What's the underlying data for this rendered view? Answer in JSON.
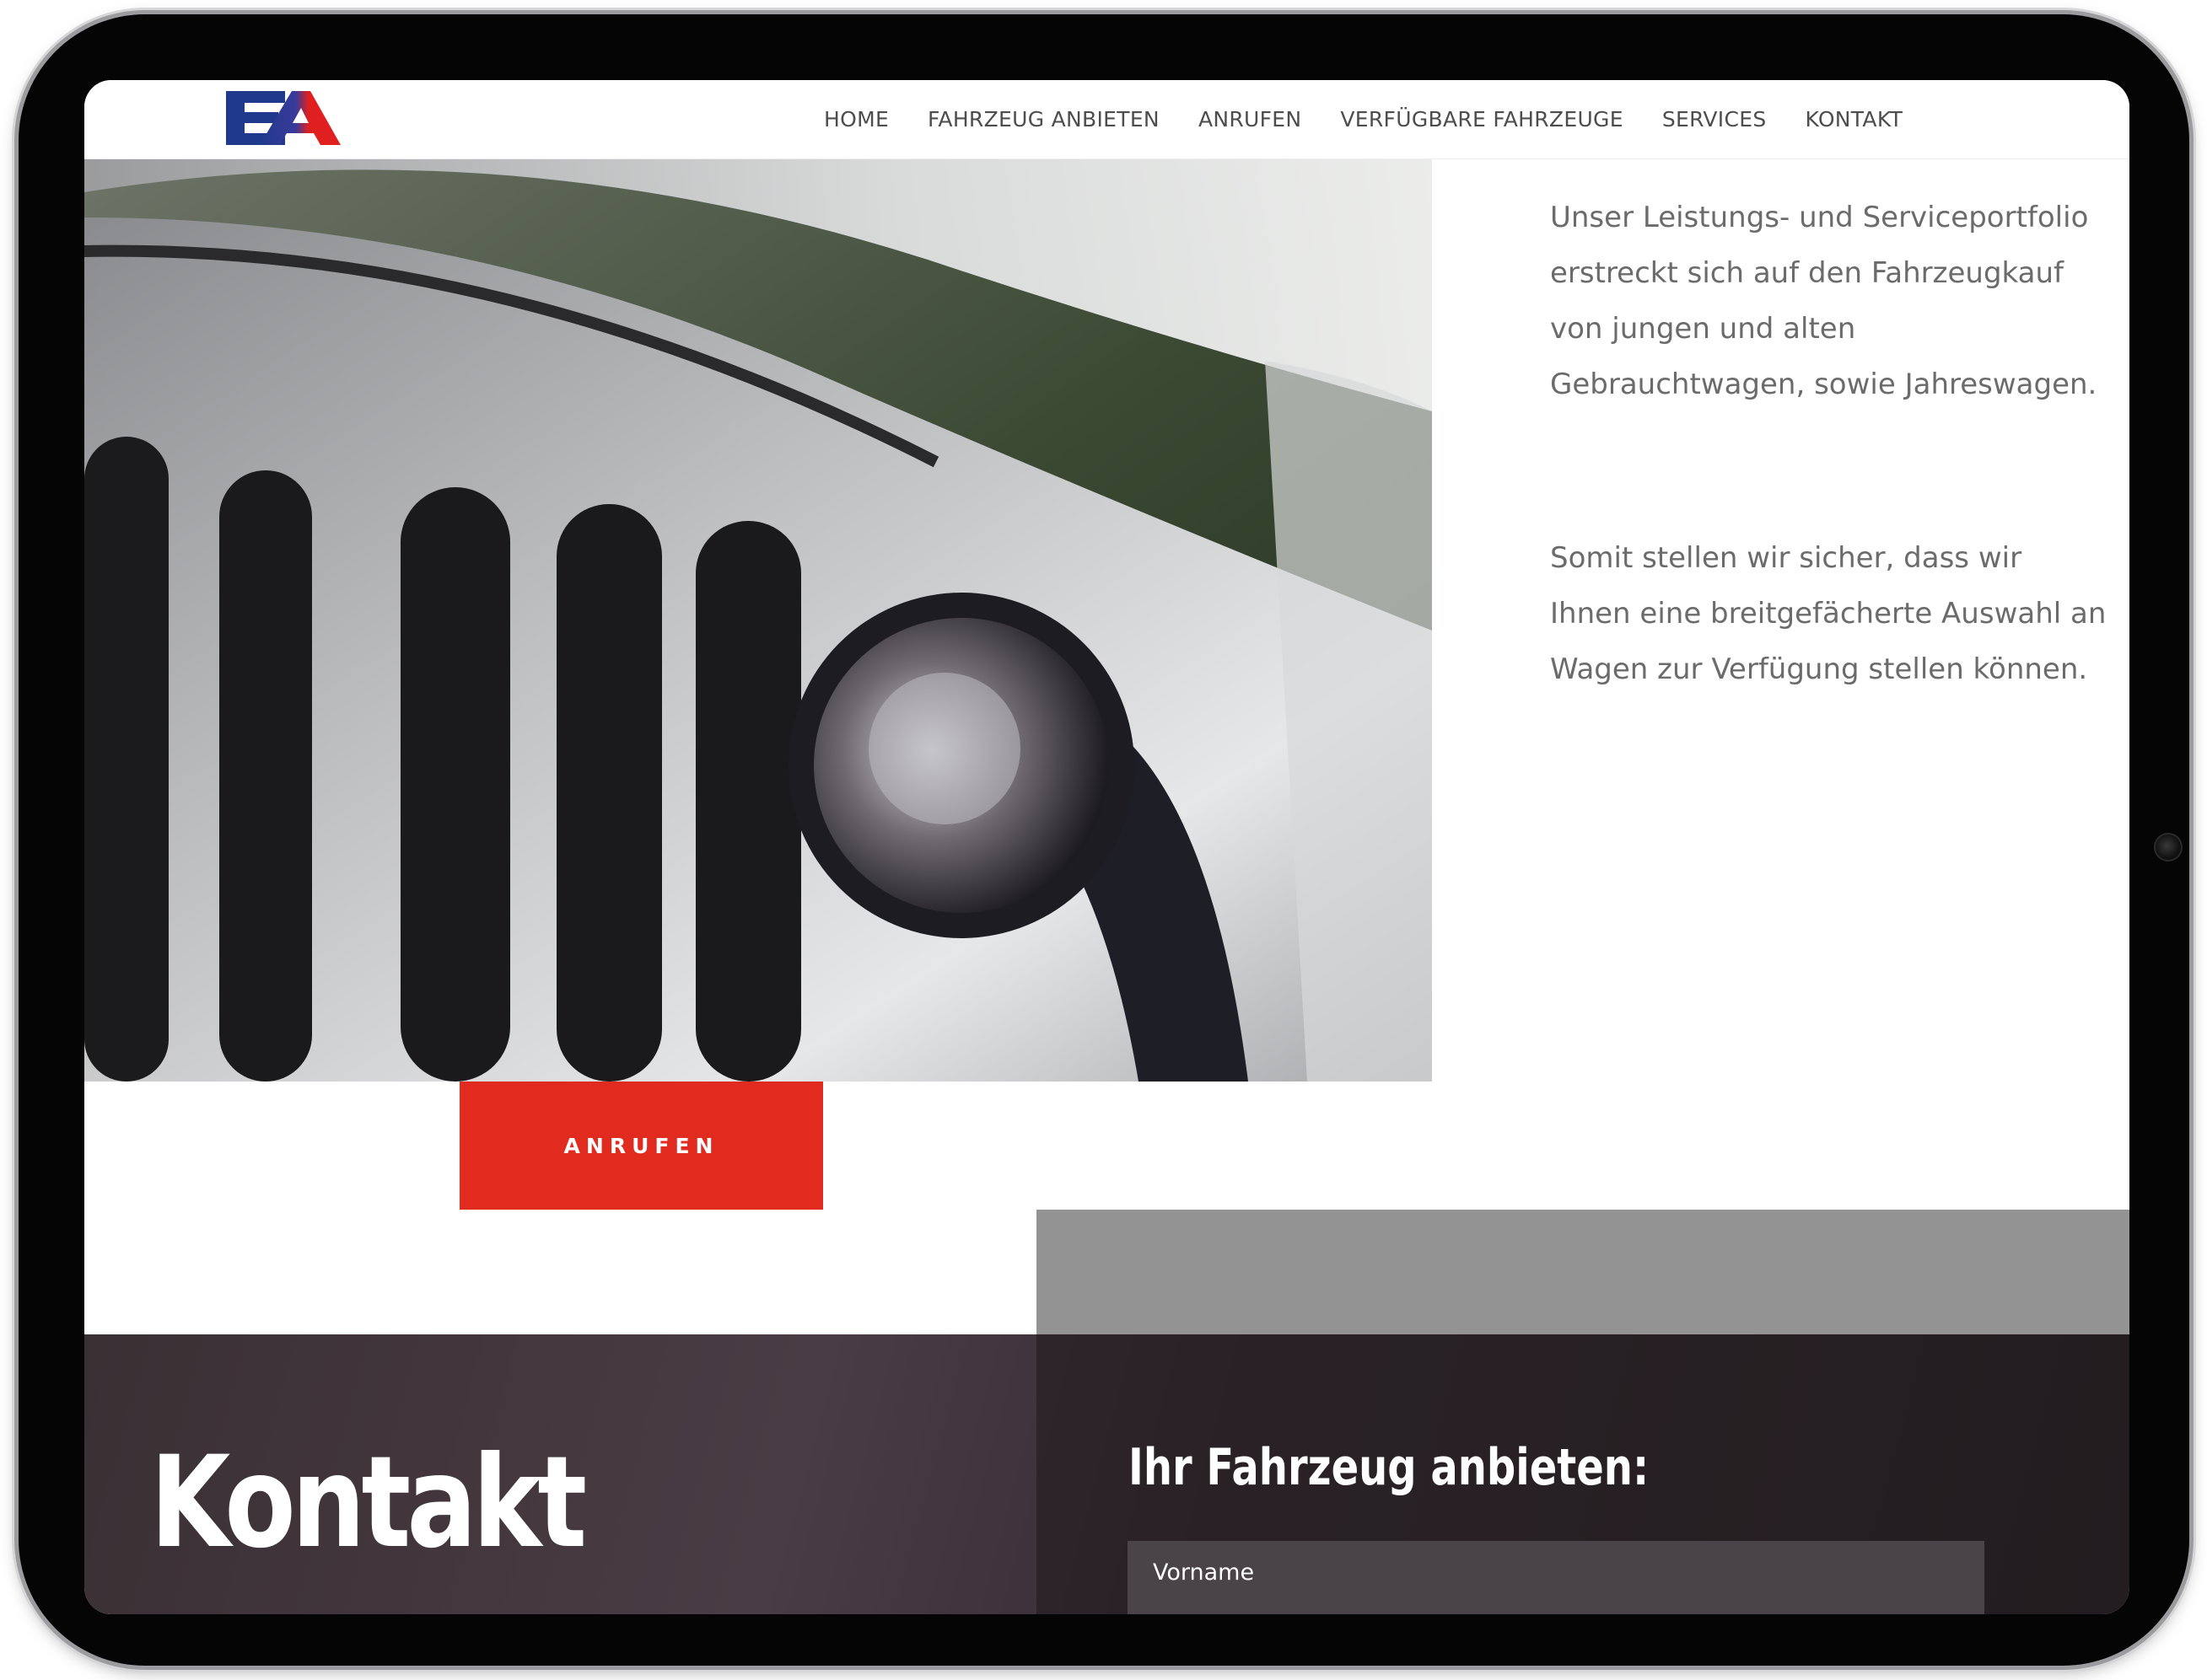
{
  "nav": {
    "items": [
      "HOME",
      "FAHRZEUG ANBIETEN",
      "ANRUFEN",
      "VERFÜGBARE FAHRZEUGE",
      "SERVICES",
      "KONTAKT"
    ]
  },
  "logo": {
    "icon": "ea-logo-icon",
    "colors": {
      "blue": "#1f3a8c",
      "red": "#e02020"
    }
  },
  "intro": {
    "paragraph_1": "Unser Leistungs- und Serviceportfolio erstreckt sich auf den Fahrzeugkauf von jungen und alten Gebrauchtwagen, sowie Jahreswagen.",
    "paragraph_2": "Somit stellen wir sicher, dass wir Ihnen eine breitgefächerte Auswahl an Wagen zur Verfügung stellen können."
  },
  "call_button": {
    "label": "ANRUFEN",
    "color": "#e12b1f"
  },
  "contact": {
    "title": "Kontakt",
    "form_title": "Ihr Fahrzeug anbieten:",
    "firstname_placeholder": "Vorname"
  }
}
